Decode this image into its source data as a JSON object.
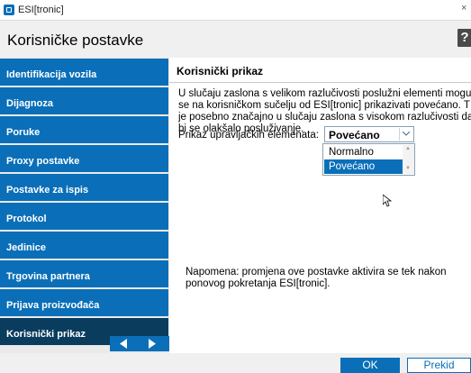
{
  "window": {
    "title": "ESI[tronic]",
    "close_glyph": "×"
  },
  "header": {
    "title": "Korisničke postavke",
    "help_glyph": "?"
  },
  "sidebar": {
    "items": [
      {
        "label": "Identifikacija vozila",
        "active": false
      },
      {
        "label": "Dijagnoza",
        "active": false
      },
      {
        "label": "Poruke",
        "active": false
      },
      {
        "label": "Proxy postavke",
        "active": false
      },
      {
        "label": "Postavke za ispis",
        "active": false
      },
      {
        "label": "Protokol",
        "active": false
      },
      {
        "label": "Jedinice",
        "active": false
      },
      {
        "label": "Trgovina partnera",
        "active": false
      },
      {
        "label": "Prijava proizvođača",
        "active": false
      },
      {
        "label": "Korisnički prikaz",
        "active": true
      }
    ],
    "pager_icons": [
      "arrow-left-icon",
      "arrow-right-icon"
    ]
  },
  "main": {
    "title": "Korisnički prikaz",
    "description_lines": [
      "U slučaju zaslona s velikom razlučivosti poslužni elementi mogu",
      "se na korisničkom sučelju od ESI[tronic] prikazivati povećano. T",
      "je posebno značajno u slučaju zaslona s visokom razlučivosti da",
      "bi se olakšalo posluživanje."
    ],
    "control_label": "Prikaz upravljačkih elemenata:",
    "combo": {
      "selected": "Povećano",
      "options": [
        "Normalno",
        "Povećano"
      ],
      "highlighted_index": 1
    },
    "note_lines": [
      "Napomena: promjena ove postavke aktivira se tek nakon",
      "ponovog pokretanja ESI[tronic]."
    ]
  },
  "footer": {
    "ok_label": "OK",
    "cancel_label": "Prekid"
  },
  "colors": {
    "accent": "#0a6fb8",
    "active_nav": "#0a3c5e"
  }
}
